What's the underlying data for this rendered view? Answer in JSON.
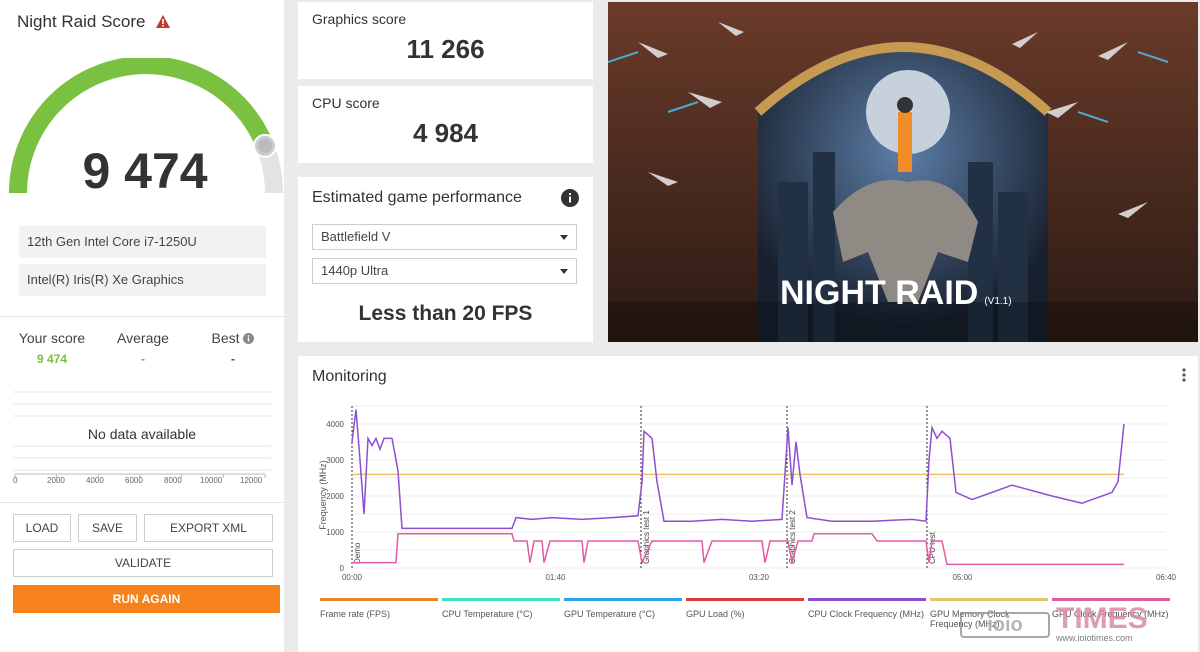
{
  "left_panel": {
    "title": "Night Raid Score",
    "score": "9 474",
    "gauge_fraction": 0.88,
    "cpu": "12th Gen Intel Core i7-1250U",
    "gpu": "Intel(R) Iris(R) Xe Graphics",
    "your_score_label": "Your score",
    "your_score_value": "9 474",
    "average_label": "Average",
    "average_value": "-",
    "best_label": "Best",
    "best_value": "-",
    "no_data": "No data available",
    "axis_ticks": [
      "0",
      "2000",
      "4000",
      "6000",
      "8000",
      "10000",
      "12000"
    ],
    "buttons": {
      "load": "LOAD",
      "save": "SAVE",
      "export": "EXPORT XML",
      "validate": "VALIDATE",
      "run_again": "RUN AGAIN"
    }
  },
  "graphics": {
    "label": "Graphics score",
    "value": "11 266"
  },
  "cpu_score": {
    "label": "CPU score",
    "value": "4 984"
  },
  "estimate": {
    "title": "Estimated game performance",
    "game": "Battlefield V",
    "setting": "1440p Ultra",
    "result": "Less than 20 FPS"
  },
  "hero": {
    "title": "NIGHT RAID",
    "version": "(V1.1)"
  },
  "monitoring": {
    "title": "Monitoring",
    "y_label": "Frequency (MHz)",
    "y_ticks": [
      "0",
      "1000",
      "2000",
      "3000",
      "4000"
    ],
    "x_ticks": [
      "00:00",
      "01:40",
      "03:20",
      "05:00",
      "06:40"
    ],
    "markers": [
      "Demo",
      "Graphics test 1",
      "Graphics test 2",
      "CPU test"
    ],
    "legend": [
      {
        "label": "Frame rate (FPS)",
        "color": "#e8832a"
      },
      {
        "label": "CPU Temperature (°C)",
        "color": "#3fe0c5"
      },
      {
        "label": "GPU Temperature (°C)",
        "color": "#2ea6e6"
      },
      {
        "label": "GPU Load (%)",
        "color": "#d83a3a"
      },
      {
        "label": "CPU Clock Frequency (MHz)",
        "color": "#8e4fcf"
      },
      {
        "label": "GPU Memory Clock Frequency (MHz)",
        "color": "#e5c46b"
      },
      {
        "label": "GPU Clock Frequency (MHz)",
        "color": "#e05ca1"
      }
    ]
  },
  "watermark": {
    "text": "TIMES",
    "url": "www.ioiotimes.com"
  },
  "colors": {
    "accent_green": "#7ac142",
    "orange": "#f7821b"
  }
}
